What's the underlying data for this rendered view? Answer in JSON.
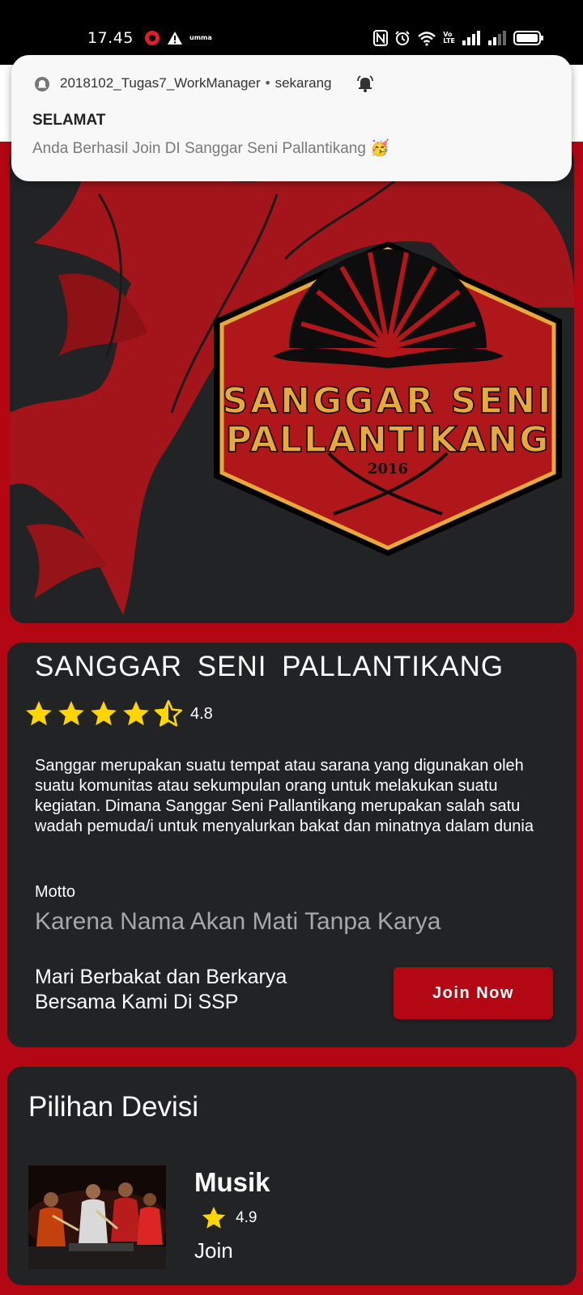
{
  "status_bar": {
    "time": "17.45",
    "carrier_tag": "umma",
    "network_label_top": "Vo",
    "network_label_bottom": "LTE"
  },
  "notification": {
    "app_name": "2018102_Tugas7_WorkManager",
    "separator": "•",
    "time": "sekarang",
    "title": "SELAMAT",
    "body": "Anda Berhasil Join DI Sanggar Seni Pallantikang 🥳"
  },
  "hero": {
    "logo_line1": "SANGGAR SENI",
    "logo_line2": "PALLANTIKANG",
    "logo_year": "2016"
  },
  "info": {
    "title": "SANGGAR  SENI  PALLANTIKANG",
    "rating": "4.8",
    "stars": 4.5,
    "description": "Sanggar merupakan suatu tempat atau sarana yang digunakan oleh suatu komunitas atau sekumpulan orang untuk melakukan suatu kegiatan. Dimana Sanggar Seni Pallantikang merupakan salah satu wadah pemuda/i untuk menyalurkan bakat dan minatnya dalam dunia",
    "motto_label": "Motto",
    "motto": "Karena Nama Akan Mati Tanpa Karya",
    "cta": "Mari Berbakat dan Berkarya Bersama Kami Di SSP",
    "join_label": "Join Now"
  },
  "divisions": {
    "title": "Pilihan Devisi",
    "items": [
      {
        "name": "Musik",
        "rating": "4.9",
        "action": "Join"
      }
    ]
  },
  "colors": {
    "brand_red": "#b30714",
    "card_dark": "#222325",
    "star_yellow": "#ffd600",
    "logo_gold": "#e6a93a"
  }
}
